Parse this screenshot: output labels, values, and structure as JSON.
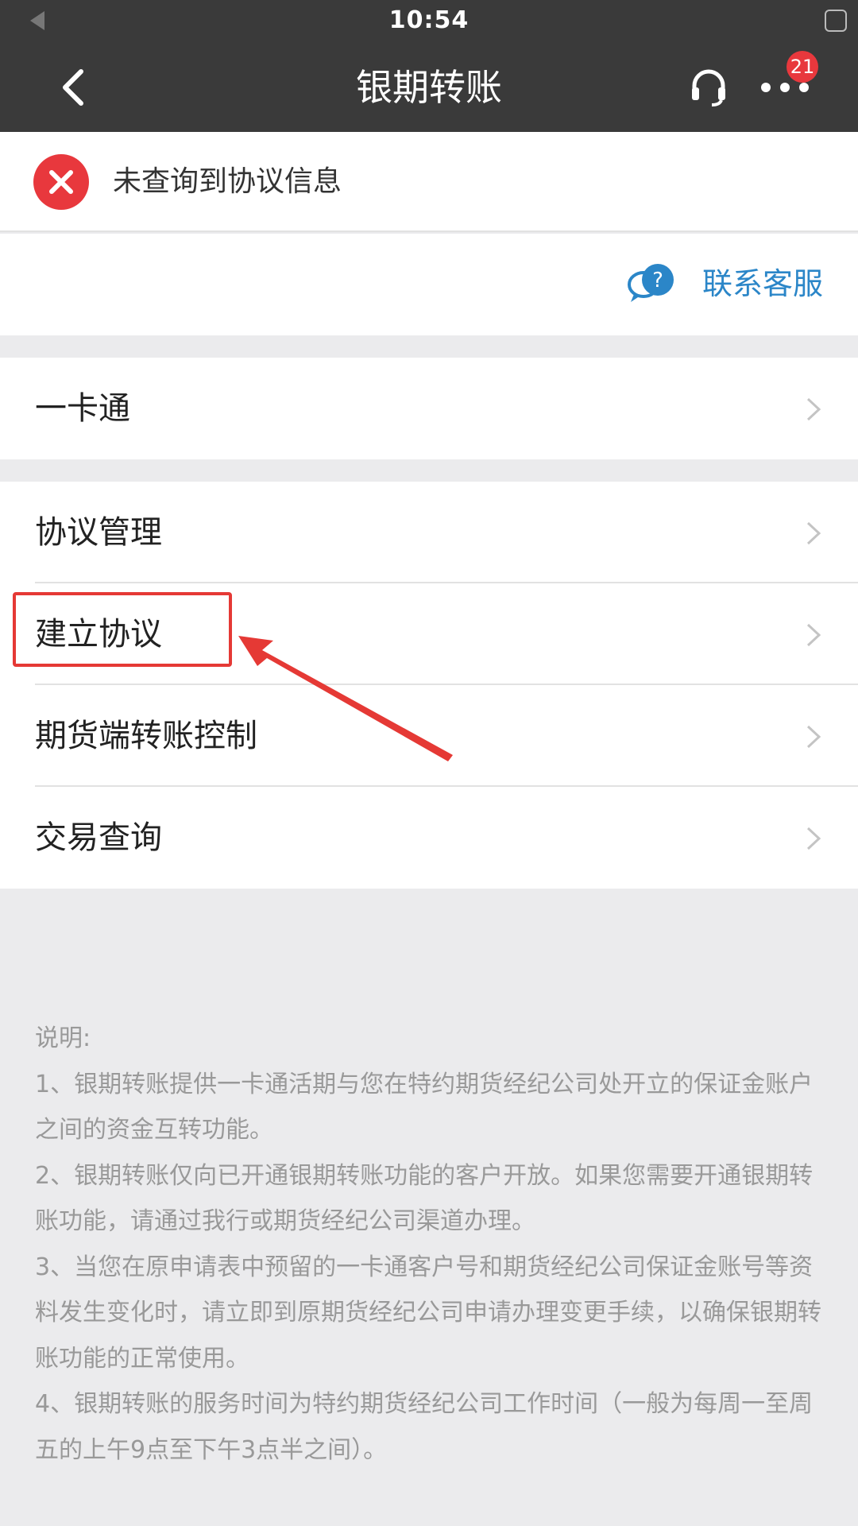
{
  "status_bar": {
    "time": "10:54"
  },
  "nav": {
    "title": "银期转账",
    "badge_count": "21"
  },
  "alert": {
    "message": "未查询到协议信息",
    "icon": "close-circle-icon",
    "color": "#e8383d"
  },
  "contact": {
    "label": "联系客服",
    "icon": "chat-question-icon",
    "color": "#2b86c8"
  },
  "menu_groups": [
    {
      "items": [
        {
          "label": "一卡通"
        }
      ]
    },
    {
      "items": [
        {
          "label": "协议管理"
        },
        {
          "label": "建立协议"
        },
        {
          "label": "期货端转账控制"
        },
        {
          "label": "交易查询"
        }
      ]
    }
  ],
  "notes": {
    "heading": "说明:",
    "items": [
      "1、银期转账提供一卡通活期与您在特约期货经纪公司处开立的保证金账户之间的资金互转功能。",
      "2、银期转账仅向已开通银期转账功能的客户开放。如果您需要开通银期转账功能，请通过我行或期货经纪公司渠道办理。",
      "3、当您在原申请表中预留的一卡通客户号和期货经纪公司保证金账号等资料发生变化时，请立即到原期货经纪公司申请办理变更手续，以确保银期转账功能的正常使用。",
      "4、银期转账的服务时间为特约期货经纪公司工作时间（一般为每周一至周五的上午9点至下午3点半之间）。"
    ]
  },
  "annotation": {
    "color": "#e53935"
  }
}
